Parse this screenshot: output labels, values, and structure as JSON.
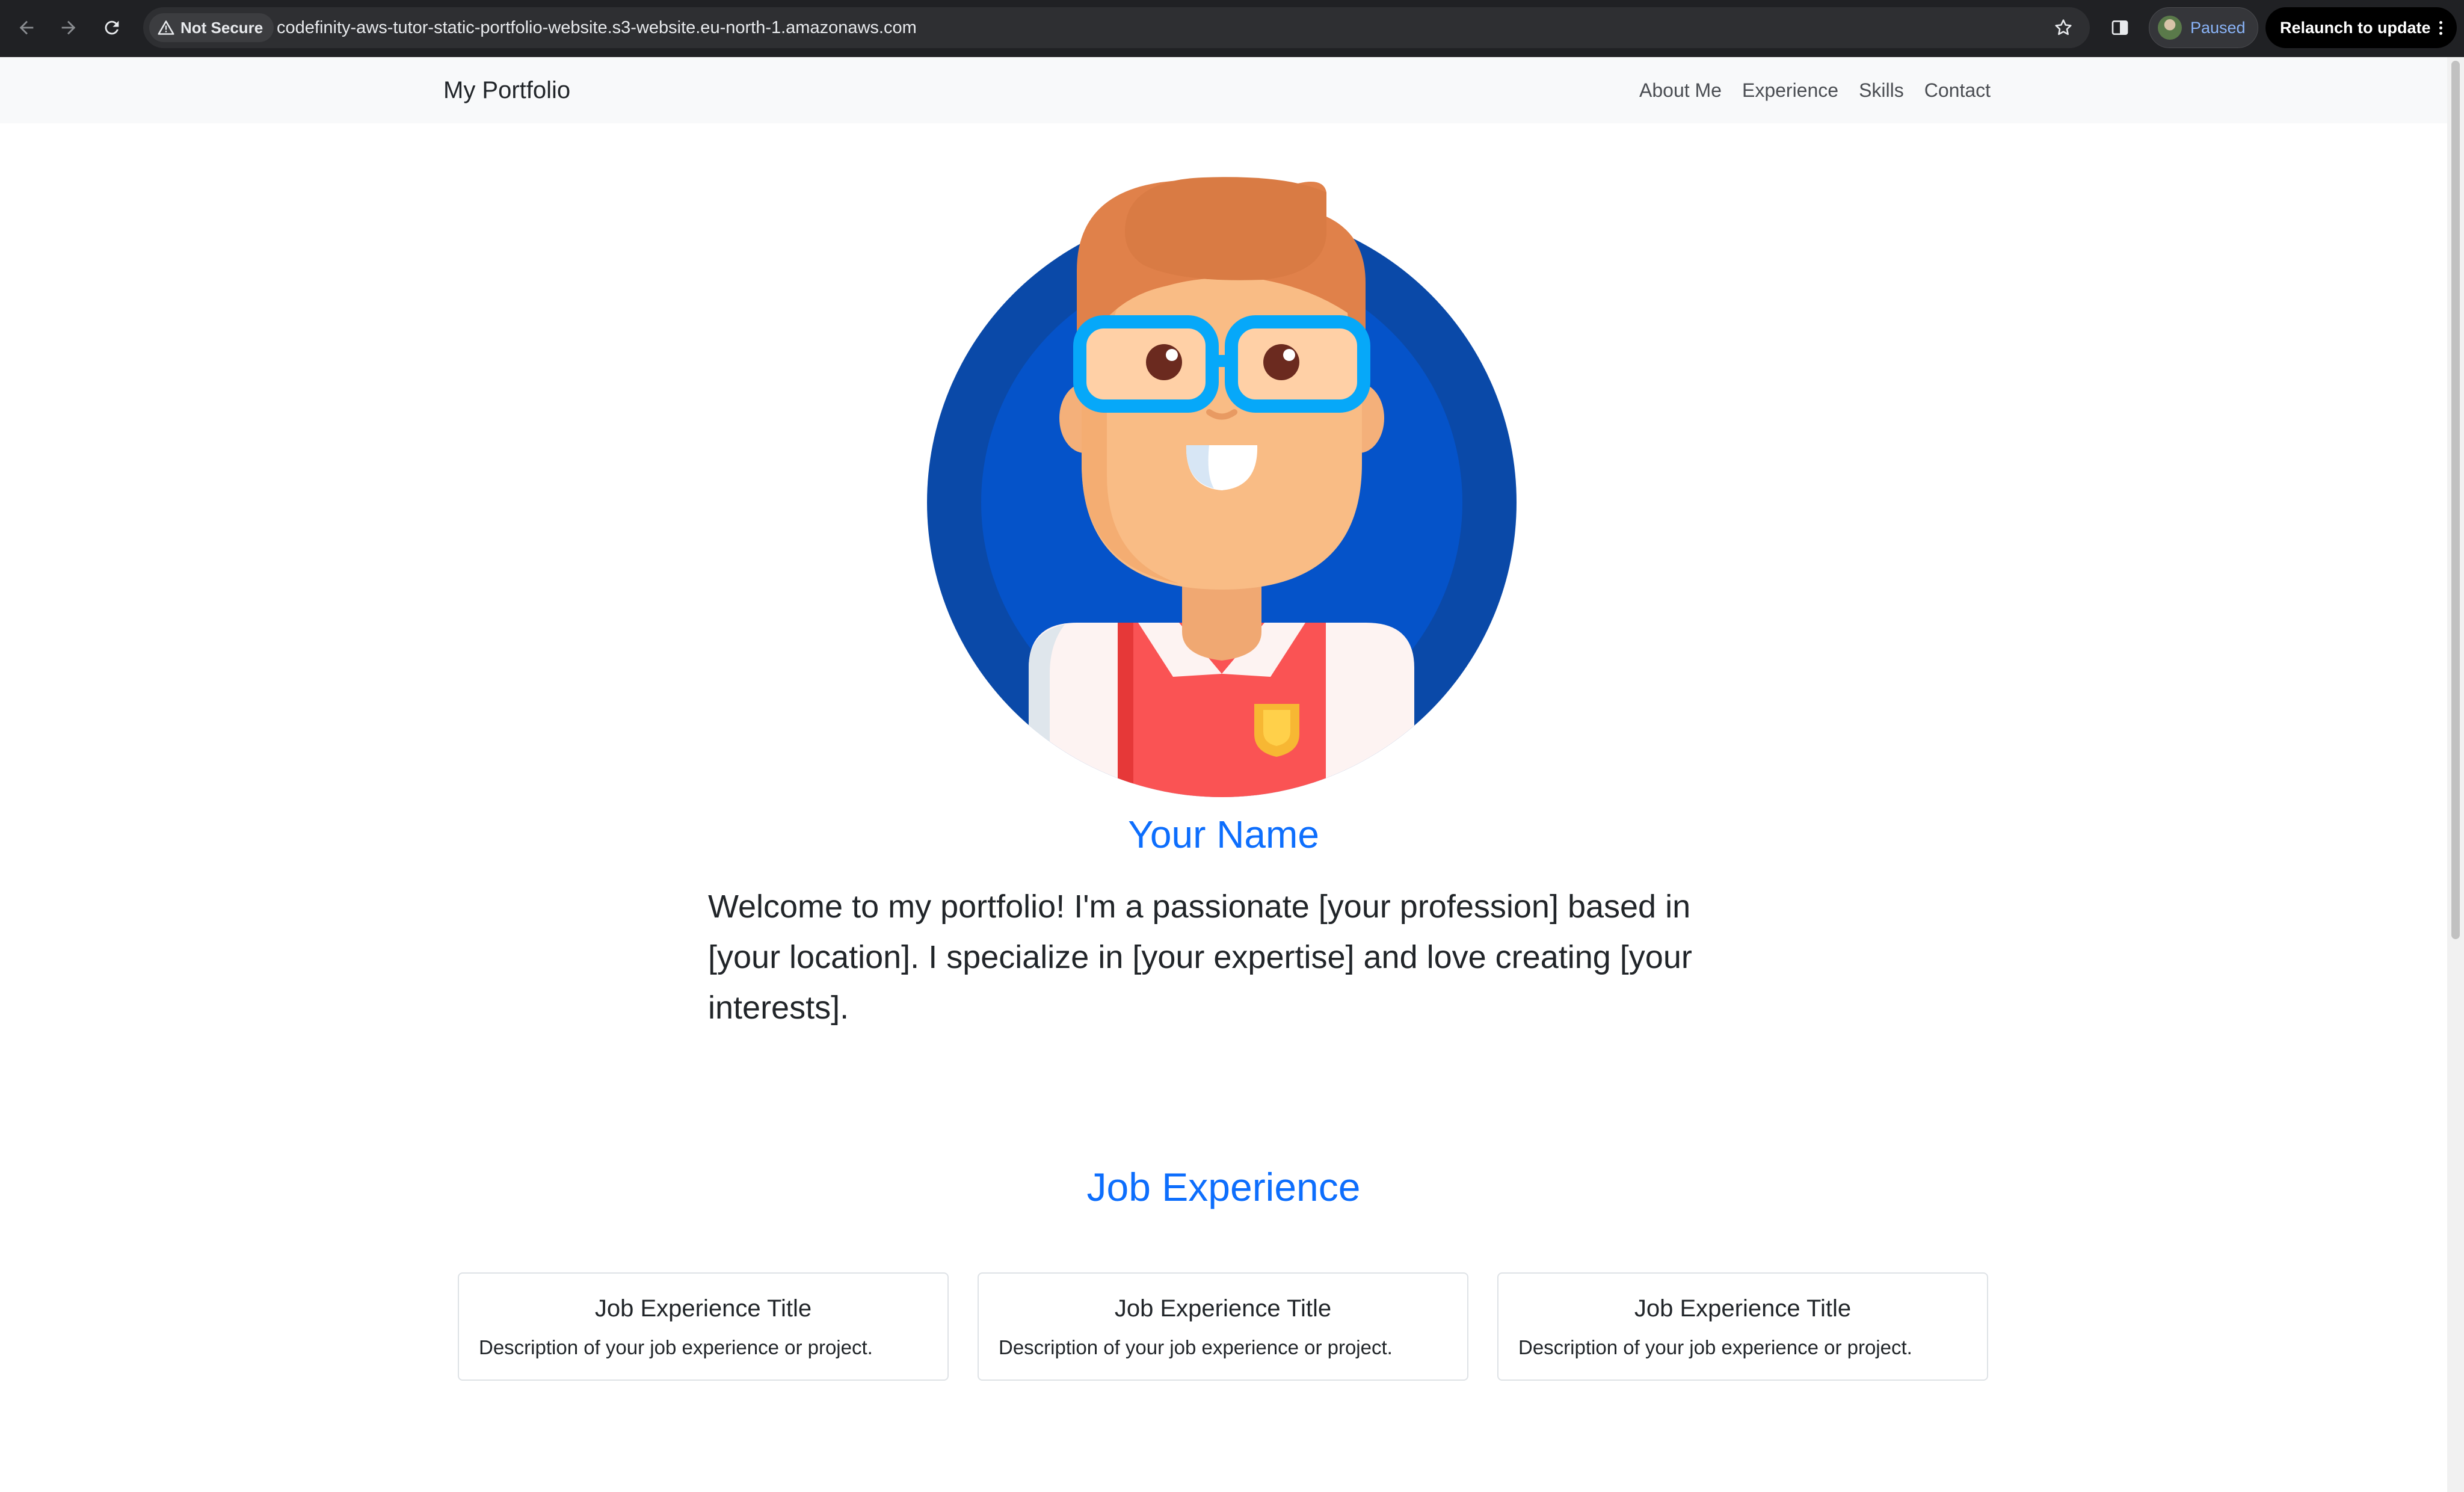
{
  "browser": {
    "security_label": "Not Secure",
    "url": "codefinity-aws-tutor-static-portfolio-website.s3-website.eu-north-1.amazonaws.com",
    "profile_status": "Paused",
    "relaunch_label": "Relaunch to update"
  },
  "nav": {
    "brand": "My Portfolio",
    "links": [
      "About Me",
      "Experience",
      "Skills",
      "Contact"
    ]
  },
  "hero": {
    "name": "Your Name",
    "intro": "Welcome to my portfolio! I'm a passionate [your profession] based in [your location]. I specialize in [your expertise] and love creating [your interests]."
  },
  "experience": {
    "heading": "Job Experience",
    "cards": [
      {
        "title": "Job Experience Title",
        "description": "Description of your job experience or project."
      },
      {
        "title": "Job Experience Title",
        "description": "Description of your job experience or project."
      },
      {
        "title": "Job Experience Title",
        "description": "Description of your job experience or project."
      }
    ]
  },
  "colors": {
    "accent": "#0d6efd",
    "navbar_bg": "#f8f9fa",
    "chrome_bg": "#202124"
  },
  "icons": [
    "back-icon",
    "forward-icon",
    "reload-icon",
    "warning-icon",
    "star-icon",
    "side-panel-icon",
    "kebab-menu-icon",
    "avatar-illustration"
  ]
}
